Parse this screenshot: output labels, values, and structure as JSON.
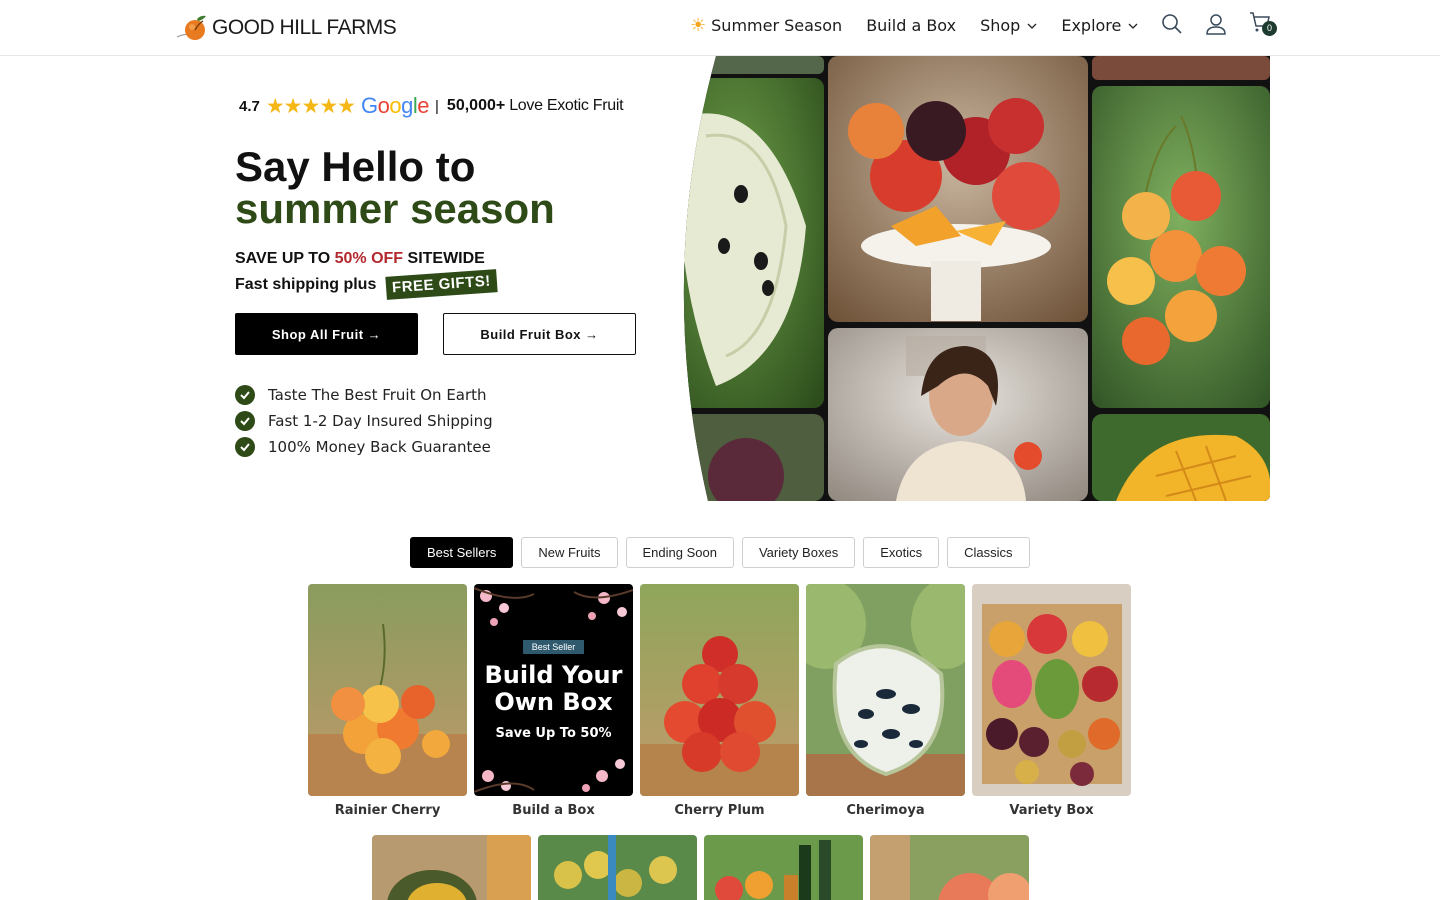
{
  "header": {
    "brand": "GOOD HILL FARMS",
    "nav": [
      {
        "label": "Summer Season",
        "icon": "sun-icon"
      },
      {
        "label": "Build a Box"
      },
      {
        "label": "Shop",
        "dropdown": true
      },
      {
        "label": "Explore",
        "dropdown": true
      }
    ],
    "cart_count": "0"
  },
  "hero": {
    "rating": "4.7",
    "stars": "★★★★★",
    "google": "Google",
    "separator": "|",
    "customer_count": "50,000+",
    "customer_tagline": "Love Exotic Fruit",
    "headline_line1": "Say Hello to",
    "headline_line2": "summer season",
    "promo_prefix": "SAVE UP TO",
    "promo_highlight": "50% OFF",
    "promo_suffix": "SITEWIDE",
    "shipping_text": "Fast shipping plus",
    "free_gifts": "FREE GIFTS!",
    "primary_button": "Shop All Fruit →",
    "secondary_button": "Build Fruit Box →",
    "features": [
      "Taste The Best Fruit On Earth",
      "Fast 1-2 Day Insured Shipping",
      "100% Money Back Guarantee"
    ]
  },
  "tabs": [
    {
      "label": "Best Sellers",
      "active": true
    },
    {
      "label": "New Fruits"
    },
    {
      "label": "Ending Soon"
    },
    {
      "label": "Variety Boxes"
    },
    {
      "label": "Exotics"
    },
    {
      "label": "Classics"
    }
  ],
  "products": [
    {
      "name": "Rainier Cherry"
    },
    {
      "name": "Build a Box",
      "badge": "Best Seller",
      "title_line1": "Build Your",
      "title_line2": "Own Box",
      "subtitle": "Save Up To 50%"
    },
    {
      "name": "Cherry Plum"
    },
    {
      "name": "Cherimoya"
    },
    {
      "name": "Variety Box"
    }
  ],
  "colors": {
    "brand_green": "#2e4a17",
    "promo_red": "#b3282d",
    "star_yellow": "#f5b715",
    "badge_teal": "#2f5a6e"
  }
}
